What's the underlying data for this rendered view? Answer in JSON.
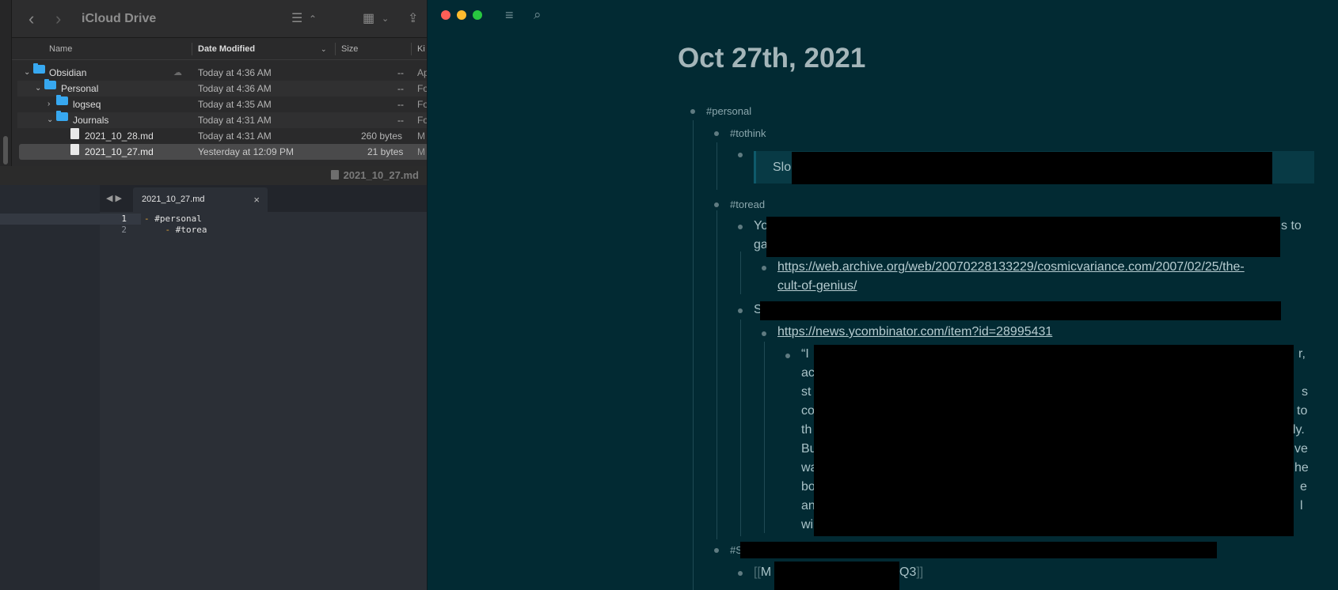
{
  "finder": {
    "title": "iCloud Drive",
    "columns": {
      "name": "Name",
      "date": "Date Modified",
      "size": "Size",
      "kind": "Ki"
    },
    "rows": [
      {
        "name": "Obsidian",
        "date": "Today at 4:36 AM",
        "size": "--",
        "kind": "Ap"
      },
      {
        "name": "Personal",
        "date": "Today at 4:36 AM",
        "size": "--",
        "kind": "Fo"
      },
      {
        "name": "logseq",
        "date": "Today at 4:35 AM",
        "size": "--",
        "kind": "Fo"
      },
      {
        "name": "Journals",
        "date": "Today at 4:31 AM",
        "size": "--",
        "kind": "Fo"
      },
      {
        "name": "2021_10_28.md",
        "date": "Today at 4:31 AM",
        "size": "260 bytes",
        "kind": "M"
      },
      {
        "name": "2021_10_27.md",
        "date": "Yesterday at 12:09 PM",
        "size": "21 bytes",
        "kind": "M"
      }
    ],
    "status_file": "2021_10_27.md"
  },
  "editor": {
    "tab_title": "2021_10_27.md",
    "close_glyph": "×",
    "lines": [
      {
        "num": "1",
        "dash": "-",
        "text": " #personal",
        "indent": ""
      },
      {
        "num": "2",
        "dash": "-",
        "text": " #torea",
        "indent": "    "
      }
    ]
  },
  "logseq": {
    "page_title": "Oct 27th, 2021",
    "tags": {
      "personal": "#personal",
      "tothink": "#tothink",
      "toread": "#toread",
      "s_tag": "#S"
    },
    "quote_prefix": "Slo",
    "toread_item_start": "Yo",
    "toread_item_end": "s to",
    "toread_item_line2": "ga",
    "link1_line1": "https://web.archive.org/web/20070228133229/cosmicvariance.com/2007/02/25/the-",
    "link1_line2": "cult-of-genius/",
    "item2_start": "S",
    "link2": "https://news.ycombinator.com/item?id=28995431",
    "quote_letters_left": [
      "“I",
      "ac",
      "st",
      "co",
      "th",
      "Bu",
      "wa",
      "bo",
      "an",
      "wi"
    ],
    "quote_letters_right": [
      "r,",
      "",
      "",
      "s",
      "to",
      "ly.",
      "ve",
      "he",
      "e",
      "l"
    ],
    "ref_open": "[[",
    "ref_start": "M",
    "ref_end": "Q3",
    "ref_close": "]]"
  }
}
